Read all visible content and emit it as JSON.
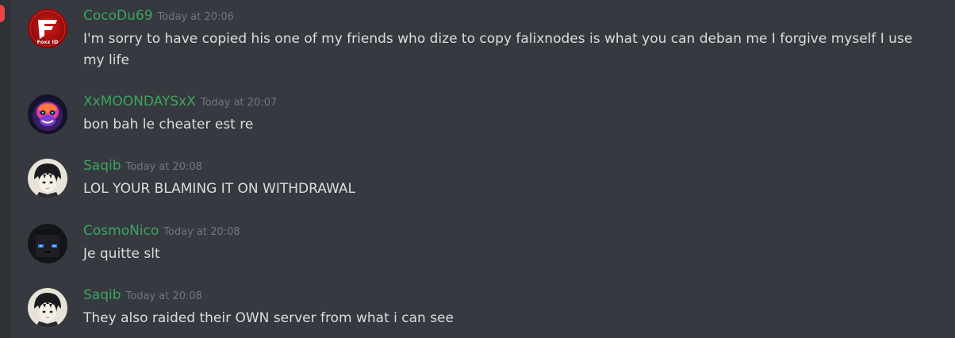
{
  "colors": {
    "background": "#36393f",
    "username": "#3ba55d",
    "timestamp": "#72767d",
    "text": "#dcddde"
  },
  "messages": [
    {
      "username": "CocoDu69",
      "timestamp": "Today at 20:06",
      "text": "I'm sorry to have copied his one of my friends who dize to copy falixnodes is what you can deban me I forgive myself I use my life",
      "avatar_icon": "red-gaming-logo-avatar",
      "avatar_caption": "Foxz ID"
    },
    {
      "username": "XxMOONDAYSxX",
      "timestamp": "Today at 20:07",
      "text": "bon bah le cheater est re",
      "avatar_icon": "neon-gorilla-avatar"
    },
    {
      "username": "Saqib",
      "timestamp": "Today at 20:08",
      "text": "LOL YOUR BLAMING IT ON WITHDRAWAL",
      "avatar_icon": "anime-boy-avatar"
    },
    {
      "username": "CosmoNico",
      "timestamp": "Today at 20:08",
      "text": "Je quitte slt",
      "avatar_icon": "dark-pixel-face-avatar"
    },
    {
      "username": "Saqib",
      "timestamp": "Today at 20:08",
      "text": "They also raided their OWN server from what i can see",
      "avatar_icon": "anime-boy-avatar"
    }
  ]
}
